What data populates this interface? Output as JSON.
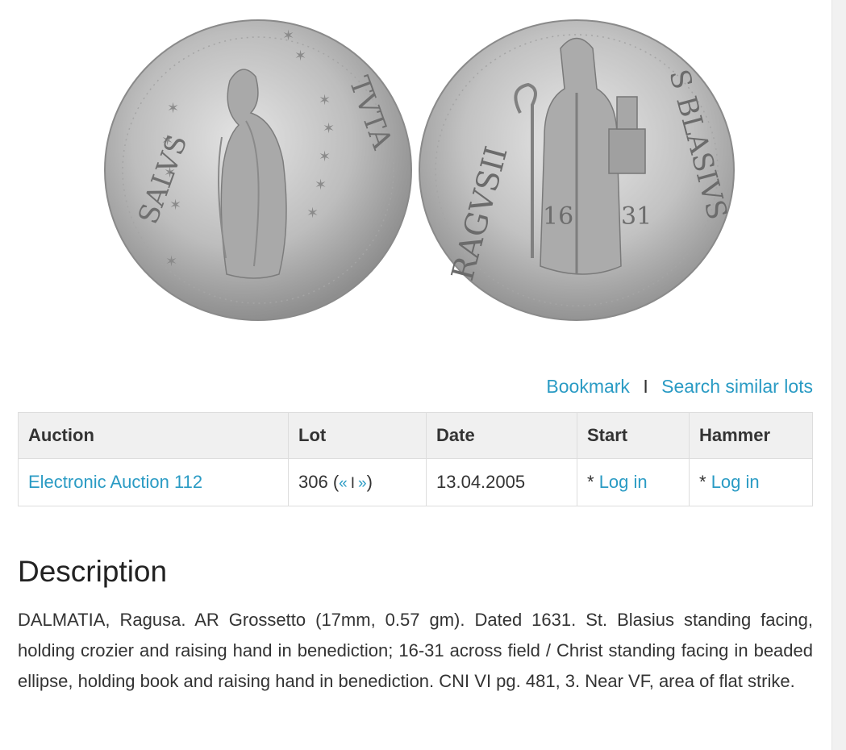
{
  "links": {
    "bookmark": "Bookmark",
    "separator": "I",
    "search_similar": "Search similar lots"
  },
  "table": {
    "headers": {
      "auction": "Auction",
      "lot": "Lot",
      "date": "Date",
      "start": "Start",
      "hammer": "Hammer"
    },
    "row": {
      "auction": "Electronic Auction 112",
      "lot_number": "306",
      "lot_open": "(",
      "prev": "«",
      "nav_sep": "I",
      "next": "»",
      "lot_close": ")",
      "date": "13.04.2005",
      "start_prefix": "*",
      "start_link": "Log in",
      "hammer_prefix": "*",
      "hammer_link": "Log in"
    }
  },
  "description": {
    "title": "Description",
    "text": "DALMATIA, Ragusa. AR Grossetto (17mm, 0.57 gm). Dated 1631. St. Blasius standing facing, holding crozier and raising hand in benediction; 16-31 across field / Christ standing facing in beaded ellipse, holding book and raising hand in benediction. CNI VI pg. 481, 3. Near VF, area of flat strike."
  },
  "coin": {
    "obverse_legend_left": "SALVS",
    "obverse_legend_right": "TVTA",
    "reverse_legend_left": "RAGVSII",
    "reverse_legend_right": "S BLASIVS",
    "date_left": "16",
    "date_right": "31",
    "metal_color": "#b9b9b9"
  },
  "colors": {
    "link": "#2a9bc4",
    "header_bg": "#f0f0f0",
    "border": "#dddddd",
    "text": "#333333"
  }
}
